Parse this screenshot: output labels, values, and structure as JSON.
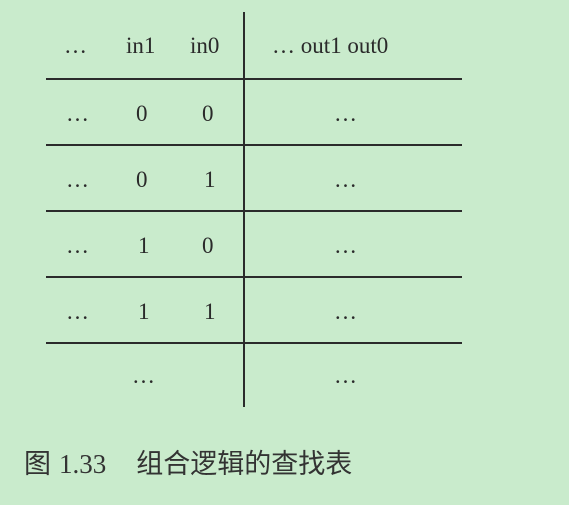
{
  "table": {
    "headers": [
      "…",
      "in1",
      "in0",
      "… out1 out0"
    ],
    "rows": [
      [
        "…",
        "0",
        "0",
        "…"
      ],
      [
        "…",
        "0",
        "1",
        "…"
      ],
      [
        "…",
        "1",
        "0",
        "…"
      ],
      [
        "…",
        "1",
        "1",
        "…"
      ],
      [
        "",
        "…",
        "",
        "…"
      ]
    ]
  },
  "caption": {
    "label": "图",
    "number": "1.33",
    "title": "组合逻辑的查找表"
  }
}
